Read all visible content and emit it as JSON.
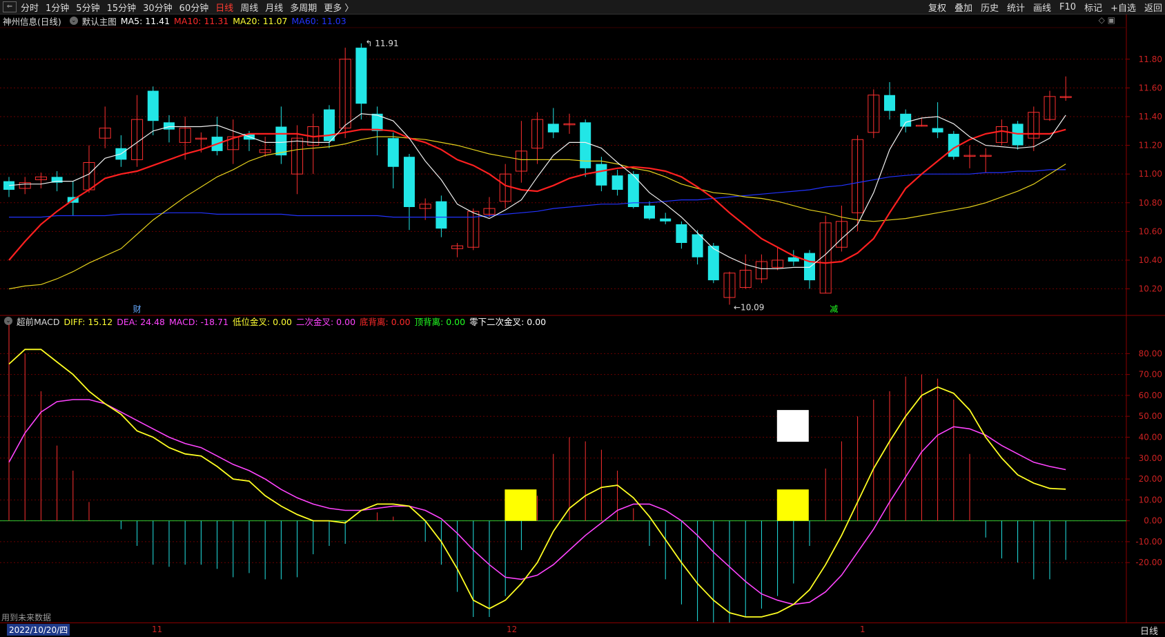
{
  "toolbar": {
    "periods": [
      "分时",
      "1分钟",
      "5分钟",
      "15分钟",
      "30分钟",
      "60分钟",
      "日线",
      "周线",
      "月线",
      "多周期",
      "更多 〉"
    ],
    "active_period": "日线",
    "right_buttons": [
      "复权",
      "叠加",
      "历史",
      "统计",
      "画线",
      "F10",
      "标记",
      "+自选",
      "返回"
    ]
  },
  "main_chart": {
    "title": "神州信息(日线)",
    "template": "默认主图",
    "ma": [
      {
        "label": "MA5: 11.41",
        "color": "#ffffff"
      },
      {
        "label": "MA10: 11.31",
        "color": "#ff2a2a"
      },
      {
        "label": "MA20: 11.07",
        "color": "#ffff33"
      },
      {
        "label": "MA60: 11.03",
        "color": "#2233ff"
      }
    ],
    "y_ticks": [
      "11.80",
      "11.60",
      "11.40",
      "11.20",
      "11.00",
      "10.80",
      "10.60",
      "10.40",
      "10.20"
    ],
    "y_range": [
      10.02,
      12.02
    ],
    "high_label": "11.91",
    "low_label": "10.09",
    "markers": {
      "cai": "财",
      "jian": "减"
    }
  },
  "macd": {
    "title": "超前MACD",
    "items": [
      {
        "label": "DIFF: 15.12",
        "color": "#ffff33"
      },
      {
        "label": "DEA: 24.48",
        "color": "#ff44ff"
      },
      {
        "label": "MACD: -18.71",
        "color": "#ff44ff"
      },
      {
        "label": "低位金叉: 0.00",
        "color": "#ffff33"
      },
      {
        "label": "二次金叉: 0.00",
        "color": "#ff44ff"
      },
      {
        "label": "底背离: 0.00",
        "color": "#ff2a2a"
      },
      {
        "label": "顶背离: 0.00",
        "color": "#22ff22"
      },
      {
        "label": "零下二次金叉: 0.00",
        "color": "#ffffff"
      }
    ],
    "y_ticks": [
      "80.00",
      "70.00",
      "60.00",
      "50.00",
      "40.00",
      "30.00",
      "20.00",
      "10.00",
      "0.00",
      "-10.00",
      "-20.00"
    ],
    "y_range": [
      -48,
      92
    ]
  },
  "footer": {
    "future_note": "用到未来数据",
    "date": "2022/10/20/四",
    "month_ticks": [
      "11",
      "12",
      "1"
    ],
    "period": "日线"
  },
  "chart_data": {
    "type": "candlestick",
    "candles": [
      [
        10.95,
        10.89,
        10.98,
        10.84
      ],
      [
        10.9,
        10.94,
        10.98,
        10.86
      ],
      [
        10.96,
        10.98,
        11.01,
        10.9
      ],
      [
        10.98,
        10.94,
        11.02,
        10.88
      ],
      [
        10.84,
        10.8,
        10.95,
        10.71
      ],
      [
        10.89,
        11.08,
        11.2,
        10.87
      ],
      [
        11.25,
        11.32,
        11.47,
        11.18
      ],
      [
        11.18,
        11.1,
        11.27,
        11.05
      ],
      [
        11.1,
        11.38,
        11.55,
        11.05
      ],
      [
        11.58,
        11.37,
        11.61,
        11.27
      ],
      [
        11.36,
        11.31,
        11.41,
        11.22
      ],
      [
        11.22,
        11.32,
        11.4,
        11.1
      ],
      [
        11.25,
        11.25,
        11.29,
        11.15
      ],
      [
        11.26,
        11.16,
        11.4,
        11.13
      ],
      [
        11.17,
        11.26,
        11.38,
        11.07
      ],
      [
        11.28,
        11.24,
        11.3,
        11.16
      ],
      [
        11.15,
        11.17,
        11.26,
        11.12
      ],
      [
        11.33,
        11.13,
        11.47,
        11.07
      ],
      [
        11.0,
        11.25,
        11.34,
        10.86
      ],
      [
        11.2,
        11.33,
        11.42,
        11.0
      ],
      [
        11.45,
        11.23,
        11.48,
        11.18
      ],
      [
        11.32,
        11.8,
        11.88,
        11.25
      ],
      [
        11.88,
        11.49,
        11.91,
        11.38
      ],
      [
        11.42,
        11.3,
        11.47,
        11.13
      ],
      [
        11.25,
        11.05,
        11.29,
        10.9
      ],
      [
        11.12,
        10.77,
        11.14,
        10.61
      ],
      [
        10.76,
        10.79,
        10.83,
        10.68
      ],
      [
        10.81,
        10.62,
        10.85,
        10.56
      ],
      [
        10.48,
        10.5,
        10.52,
        10.42
      ],
      [
        10.49,
        10.74,
        10.76,
        10.47
      ],
      [
        10.72,
        10.76,
        10.84,
        10.7
      ],
      [
        10.81,
        11.0,
        11.07,
        10.76
      ],
      [
        11.02,
        11.16,
        11.37,
        10.94
      ],
      [
        11.18,
        11.38,
        11.43,
        11.07
      ],
      [
        11.35,
        11.29,
        11.46,
        11.25
      ],
      [
        11.35,
        11.35,
        11.42,
        11.28
      ],
      [
        11.36,
        11.04,
        11.38,
        10.98
      ],
      [
        11.07,
        10.92,
        11.12,
        10.88
      ],
      [
        10.99,
        10.89,
        11.03,
        10.85
      ],
      [
        11.0,
        10.77,
        11.02,
        10.76
      ],
      [
        10.78,
        10.69,
        10.81,
        10.68
      ],
      [
        10.69,
        10.67,
        10.73,
        10.65
      ],
      [
        10.65,
        10.52,
        10.67,
        10.48
      ],
      [
        10.58,
        10.42,
        10.61,
        10.37
      ],
      [
        10.5,
        10.26,
        10.52,
        10.24
      ],
      [
        10.14,
        10.31,
        10.32,
        10.09
      ],
      [
        10.21,
        10.33,
        10.44,
        10.2
      ],
      [
        10.27,
        10.39,
        10.44,
        10.24
      ],
      [
        10.35,
        10.4,
        10.49,
        10.33
      ],
      [
        10.42,
        10.39,
        10.47,
        10.36
      ],
      [
        10.45,
        10.26,
        10.47,
        10.2
      ],
      [
        10.17,
        10.66,
        10.71,
        10.17
      ],
      [
        10.49,
        10.67,
        10.78,
        10.46
      ],
      [
        10.73,
        11.24,
        11.27,
        10.6
      ],
      [
        11.29,
        11.55,
        11.59,
        11.25
      ],
      [
        11.55,
        11.44,
        11.64,
        11.38
      ],
      [
        11.42,
        11.33,
        11.45,
        11.29
      ],
      [
        11.34,
        11.34,
        11.39,
        11.33
      ],
      [
        11.32,
        11.29,
        11.5,
        11.25
      ],
      [
        11.28,
        11.12,
        11.3,
        11.1
      ],
      [
        11.13,
        11.13,
        11.2,
        11.04
      ],
      [
        11.13,
        11.13,
        11.18,
        11.01
      ],
      [
        11.22,
        11.33,
        11.38,
        11.2
      ],
      [
        11.35,
        11.2,
        11.37,
        11.17
      ],
      [
        11.25,
        11.43,
        11.47,
        11.16
      ],
      [
        11.38,
        11.54,
        11.58,
        11.37
      ],
      [
        11.54,
        11.54,
        11.68,
        11.51
      ]
    ],
    "ma5": [
      10.92,
      10.93,
      10.93,
      10.95,
      10.95,
      11.0,
      11.11,
      11.14,
      11.22,
      11.3,
      11.33,
      11.33,
      11.33,
      11.34,
      11.3,
      11.26,
      11.22,
      11.22,
      11.23,
      11.22,
      11.22,
      11.34,
      11.42,
      11.41,
      11.37,
      11.25,
      11.09,
      10.96,
      10.79,
      10.73,
      10.69,
      10.75,
      10.82,
      10.98,
      11.13,
      11.22,
      11.22,
      11.18,
      11.08,
      10.99,
      10.87,
      10.79,
      10.7,
      10.59,
      10.48,
      10.42,
      10.37,
      10.34,
      10.34,
      10.35,
      10.35,
      10.44,
      10.55,
      10.65,
      10.87,
      11.17,
      11.36,
      11.39,
      11.4,
      11.35,
      11.26,
      11.2,
      11.19,
      11.18,
      11.19,
      11.25,
      11.41
    ],
    "ma10": [
      10.4,
      10.53,
      10.65,
      10.74,
      10.82,
      10.89,
      10.97,
      11.0,
      11.02,
      11.06,
      11.1,
      11.14,
      11.17,
      11.21,
      11.25,
      11.28,
      11.28,
      11.28,
      11.28,
      11.26,
      11.27,
      11.29,
      11.31,
      11.31,
      11.3,
      11.25,
      11.22,
      11.17,
      11.1,
      11.06,
      11.0,
      10.92,
      10.89,
      10.88,
      10.92,
      10.97,
      11.0,
      11.02,
      11.04,
      11.05,
      11.04,
      11.02,
      10.98,
      10.91,
      10.83,
      10.73,
      10.64,
      10.55,
      10.49,
      10.43,
      10.39,
      10.38,
      10.39,
      10.45,
      10.55,
      10.73,
      10.9,
      11.0,
      11.09,
      11.18,
      11.24,
      11.28,
      11.3,
      11.28,
      11.28,
      11.28,
      11.31
    ],
    "ma20": [
      10.2,
      10.22,
      10.23,
      10.27,
      10.32,
      10.38,
      10.43,
      10.48,
      10.58,
      10.68,
      10.76,
      10.84,
      10.91,
      10.98,
      11.03,
      11.09,
      11.13,
      11.15,
      11.17,
      11.18,
      11.19,
      11.21,
      11.24,
      11.26,
      11.26,
      11.25,
      11.24,
      11.22,
      11.2,
      11.17,
      11.14,
      11.12,
      11.1,
      11.1,
      11.1,
      11.1,
      11.09,
      11.09,
      11.07,
      11.04,
      11.02,
      10.98,
      10.93,
      10.9,
      10.87,
      10.86,
      10.84,
      10.83,
      10.81,
      10.78,
      10.75,
      10.73,
      10.7,
      10.68,
      10.67,
      10.68,
      10.69,
      10.71,
      10.73,
      10.75,
      10.77,
      10.8,
      10.84,
      10.88,
      10.93,
      11.0,
      11.07
    ],
    "ma60": [
      10.7,
      10.7,
      10.7,
      10.71,
      10.71,
      10.71,
      10.71,
      10.72,
      10.72,
      10.72,
      10.73,
      10.73,
      10.73,
      10.72,
      10.72,
      10.72,
      10.72,
      10.72,
      10.71,
      10.71,
      10.71,
      10.71,
      10.71,
      10.71,
      10.7,
      10.7,
      10.7,
      10.7,
      10.7,
      10.7,
      10.71,
      10.72,
      10.73,
      10.74,
      10.76,
      10.77,
      10.78,
      10.79,
      10.79,
      10.8,
      10.8,
      10.81,
      10.82,
      10.82,
      10.83,
      10.84,
      10.85,
      10.86,
      10.87,
      10.88,
      10.89,
      10.91,
      10.92,
      10.94,
      10.96,
      10.98,
      10.99,
      11.0,
      11.0,
      11.0,
      11.0,
      11.01,
      11.01,
      11.02,
      11.02,
      11.03,
      11.03
    ],
    "diff": [
      75,
      82,
      82,
      76,
      70,
      62,
      56,
      51,
      43,
      40,
      35,
      32,
      31,
      26,
      20,
      19,
      12,
      7,
      3,
      0,
      0,
      -1,
      5,
      8,
      8,
      7,
      0,
      -10,
      -23,
      -38,
      -42,
      -38,
      -30,
      -20,
      -5,
      6,
      12,
      16,
      17,
      11,
      2,
      -9,
      -20,
      -30,
      -38,
      -44,
      -46,
      -46,
      -44,
      -40,
      -33,
      -21,
      -7,
      9,
      25,
      38,
      50,
      60,
      64,
      61,
      53,
      40,
      30,
      22,
      18,
      15.5,
      15.12
    ],
    "dea": [
      28,
      42,
      52,
      57,
      58,
      58,
      56,
      52,
      48,
      44,
      40,
      37,
      35,
      31,
      27,
      24,
      20,
      15,
      11,
      8,
      6,
      5,
      5,
      6,
      7,
      7,
      5,
      1,
      -6,
      -14,
      -21,
      -27,
      -28,
      -26,
      -21,
      -14,
      -7,
      -1,
      5,
      8,
      8,
      5,
      0,
      -7,
      -15,
      -22,
      -29,
      -35,
      -38,
      -40,
      -39,
      -34,
      -26,
      -15,
      -4,
      9,
      21,
      33,
      41,
      45,
      44,
      41,
      36,
      32,
      28,
      26,
      24.48
    ],
    "macd_hist": [
      94,
      80,
      62,
      36,
      24,
      9,
      0,
      -4,
      -12,
      -21,
      -22,
      -21,
      -21,
      -23,
      -27,
      -25,
      -28,
      -28,
      -27,
      -16,
      -12,
      -11,
      0,
      4,
      2,
      0,
      -10,
      -21,
      -34,
      -46,
      -46,
      -36,
      -14,
      12,
      32,
      40,
      38,
      34,
      24,
      6,
      -12,
      -28,
      -40,
      -48,
      -52,
      -52,
      -46,
      -42,
      -36,
      -30,
      -12,
      25,
      38,
      50,
      58,
      62,
      69,
      70,
      68,
      58,
      32,
      -8,
      -18,
      -20,
      -28,
      -28,
      -18.71
    ],
    "signal_boxes": [
      {
        "index": 32,
        "color": "#ffff00",
        "level": 15
      },
      {
        "index": 49,
        "color": "#ffff00",
        "level": 15
      },
      {
        "index": 49,
        "color": "#ffffff",
        "level": 53
      }
    ]
  }
}
